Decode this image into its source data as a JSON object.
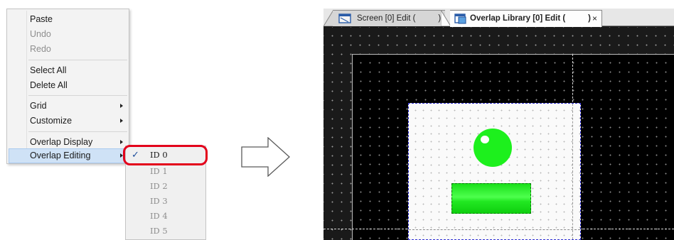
{
  "context_menu": {
    "items": [
      {
        "label": "Paste",
        "disabled": false
      },
      {
        "label": "Undo",
        "disabled": true
      },
      {
        "label": "Redo",
        "disabled": true
      },
      {
        "label": "Select All",
        "disabled": false
      },
      {
        "label": "Delete All",
        "disabled": false
      },
      {
        "label": "Grid",
        "disabled": false,
        "submenu": true
      },
      {
        "label": "Customize",
        "disabled": false,
        "submenu": true
      },
      {
        "label": "Overlap Display",
        "disabled": false,
        "submenu": true
      },
      {
        "label": "Overlap Editing",
        "disabled": false,
        "submenu": true,
        "highlighted": true
      }
    ]
  },
  "overlap_submenu": {
    "items": [
      {
        "label": "ID 0",
        "checked": true
      },
      {
        "label": "ID 1",
        "checked": false
      },
      {
        "label": "ID 2",
        "checked": false
      },
      {
        "label": "ID 3",
        "checked": false
      },
      {
        "label": "ID 4",
        "checked": false
      },
      {
        "label": "ID 5",
        "checked": false
      }
    ],
    "check_glyph": "✓"
  },
  "editor": {
    "tabs": [
      {
        "label": "Screen [0] Edit (          )",
        "active": false,
        "icon": "screen-edit-icon"
      },
      {
        "label": "Overlap Library [0] Edit (          )",
        "active": true,
        "icon": "overlap-library-icon",
        "close_glyph": "×"
      }
    ]
  },
  "colors": {
    "highlight_ring": "#e3001b",
    "lamp_green": "#1df01d",
    "selection_dash": "#2d2dd4",
    "canvas_bg": "#000000"
  }
}
